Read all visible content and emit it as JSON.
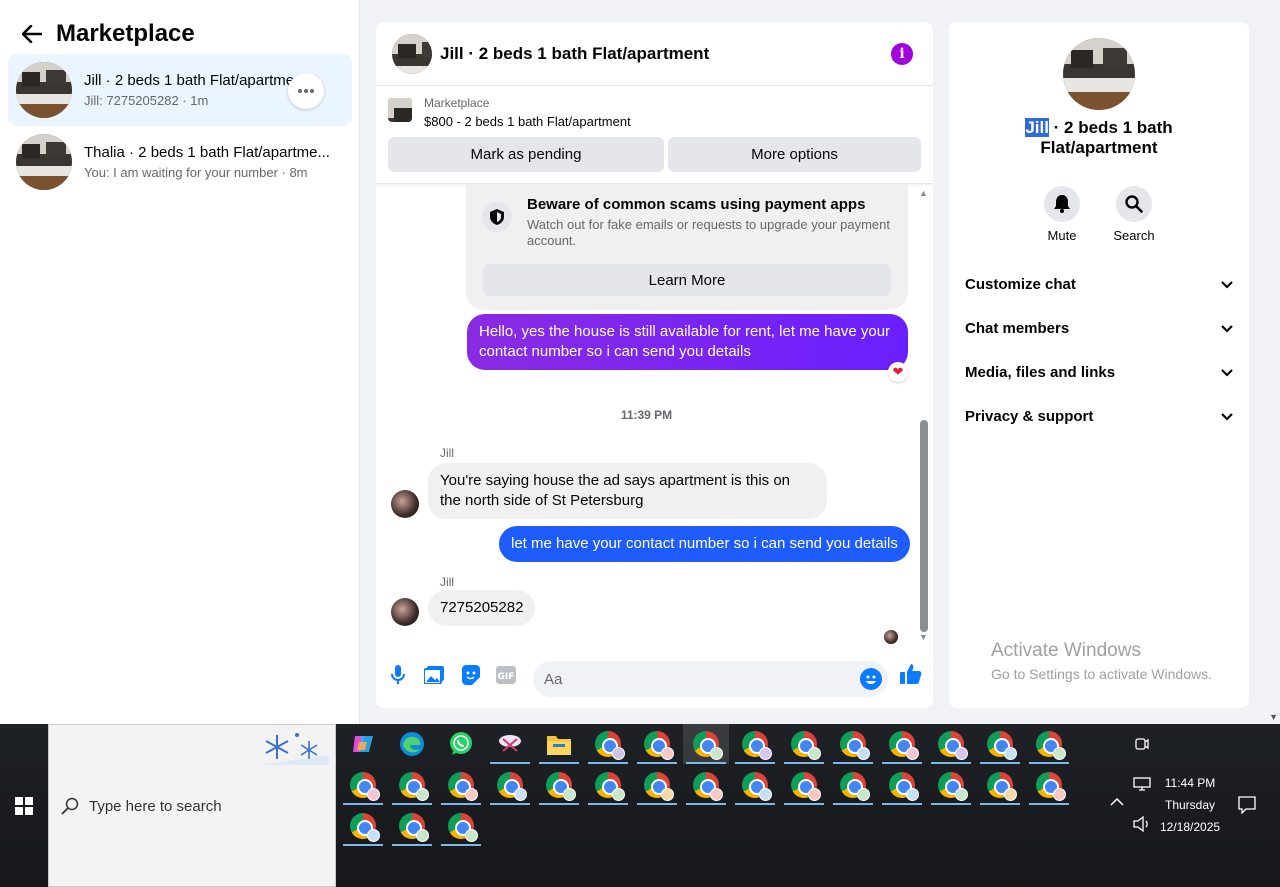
{
  "left": {
    "title": "Marketplace",
    "conversations": [
      {
        "title": "Jill · 2 beds 1 bath Flat/apartment",
        "subtitle": "Jill: 7275205282 · 1m"
      },
      {
        "title": "Thalia · 2 beds 1 bath Flat/apartme...",
        "subtitle": "You: I am waiting for your number · 8m"
      }
    ]
  },
  "chat": {
    "title": "Jill · 2 beds 1 bath Flat/apartment",
    "listing_source": "Marketplace",
    "listing_title": "$800 - 2 beds 1 bath Flat/apartment",
    "btn_pending": "Mark as pending",
    "btn_more": "More options",
    "scam_title": "Beware of common scams using payment apps",
    "scam_desc": "Watch out for fake emails or requests to upgrade your payment account.",
    "learn_more": "Learn More",
    "msg_out1": "Hello, yes the house is still available for rent, let me have your contact number so i can send you details",
    "timestamp": "11:39 PM",
    "sender1": "Jill",
    "msg_in1": "You're saying house the ad says apartment is this on the north side of St Petersburg",
    "msg_out2": "let me have your contact number so i can send you details",
    "sender2": "Jill",
    "msg_in2": "7275205282",
    "composer_placeholder": "Aa"
  },
  "right": {
    "name_highlight": "Jill",
    "name_rest": " · 2 beds 1 bath Flat/apartment",
    "mute": "Mute",
    "search": "Search",
    "sections": [
      "Customize chat",
      "Chat members",
      "Media, files and links",
      "Privacy & support"
    ]
  },
  "watermark": {
    "line1": "Activate Windows",
    "line2": "Go to Settings to activate Windows."
  },
  "taskbar": {
    "search_placeholder": "Type here to search",
    "time": "11:44 PM",
    "day": "Thursday",
    "date": "12/18/2025"
  },
  "colors": {
    "messenger_purple": "#a100dd",
    "outgoing_blue": "#1f5cff",
    "selected_conversation": "#ebf5ff"
  }
}
